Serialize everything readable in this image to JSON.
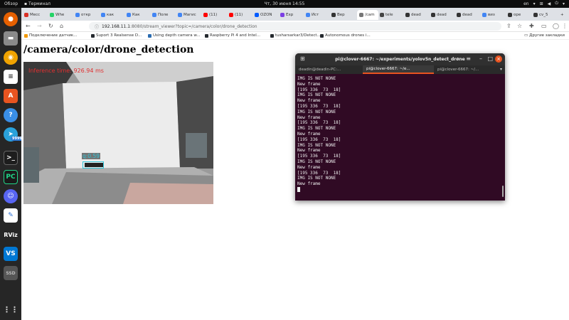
{
  "topbar": {
    "overview": "Обзор",
    "app_name": "Терминал",
    "clock": "Чт, 30 июня 14:55",
    "layout": "en"
  },
  "dock": {
    "telegram_badge": "9999",
    "rviz_label": "RViz",
    "vscode_label": "VS",
    "ssd_label": "SSD"
  },
  "browser": {
    "tabs": [
      {
        "label": "Месс",
        "color": "#d93025"
      },
      {
        "label": "Whe",
        "color": "#25d366"
      },
      {
        "label": "откр",
        "color": "#4285f4"
      },
      {
        "label": "как",
        "color": "#4285f4"
      },
      {
        "label": "Как",
        "color": "#4285f4"
      },
      {
        "label": "Поле",
        "color": "#4285f4"
      },
      {
        "label": "Магис",
        "color": "#4285f4"
      },
      {
        "label": "(11)",
        "color": "#ff0000"
      },
      {
        "label": "(11)",
        "color": "#ff0000"
      },
      {
        "label": "OZON",
        "color": "#005bff"
      },
      {
        "label": "Exp",
        "color": "#7b3fe4"
      },
      {
        "label": "Ист",
        "color": "#4285f4"
      },
      {
        "label": "Вер",
        "color": "#333333"
      },
      {
        "label": "/cam",
        "color": "#777777"
      },
      {
        "label": "tele",
        "color": "#444444"
      },
      {
        "label": "dead",
        "color": "#333333"
      },
      {
        "label": "dead",
        "color": "#333333"
      },
      {
        "label": "dead",
        "color": "#333333"
      },
      {
        "label": "виз",
        "color": "#4285f4"
      },
      {
        "label": "ope",
        "color": "#333333"
      },
      {
        "label": "cv_5",
        "color": "#333333"
      }
    ],
    "url_host": "192.168.11.1",
    "url_rest": ":8080/stream_viewer?topic=/camera/color/drone_detection",
    "bookmarks": [
      {
        "label": "Подключение датчик...",
        "color": "#f29900"
      },
      {
        "label": "Suport 3 Realsense D...",
        "color": "#24292e"
      },
      {
        "label": "Using depth camera w...",
        "color": "#2b6cb0"
      },
      {
        "label": "Raspberry Pi 4 and Intel...",
        "color": "#24292e"
      },
      {
        "label": "tusharsarkar3/Detect...",
        "color": "#24292e"
      },
      {
        "label": "Autonomous drones i...",
        "color": "#24292e"
      }
    ],
    "other_bookmarks": "Другие закладки"
  },
  "page": {
    "title": "/camera/color/drone_detection",
    "inference_text": "Inference time: 926.94 ms",
    "detection_label": "q:0.59"
  },
  "terminal": {
    "title": "pi@clover-6667: ~/experiments/yolov5n_detect_drone",
    "tabs": [
      "deadin@deadin-PC:...",
      "pi@clover-6667: ~/e...",
      "pi@clover-6667: ~/..."
    ],
    "lines": [
      "IMG IS NOT NONE",
      "New frame",
      "[195 336  73  18]",
      "IMG IS NOT NONE",
      "New frame",
      "[195 336  73  18]",
      "IMG IS NOT NONE",
      "New frame",
      "[195 336  73  18]",
      "IMG IS NOT NONE",
      "New frame",
      "[195 336  73  18]",
      "IMG IS NOT NONE",
      "New frame",
      "[195 336  73  18]",
      "IMG IS NOT NONE",
      "New frame",
      "[195 336  73  18]",
      "IMG IS NOT NONE",
      "New frame"
    ]
  }
}
